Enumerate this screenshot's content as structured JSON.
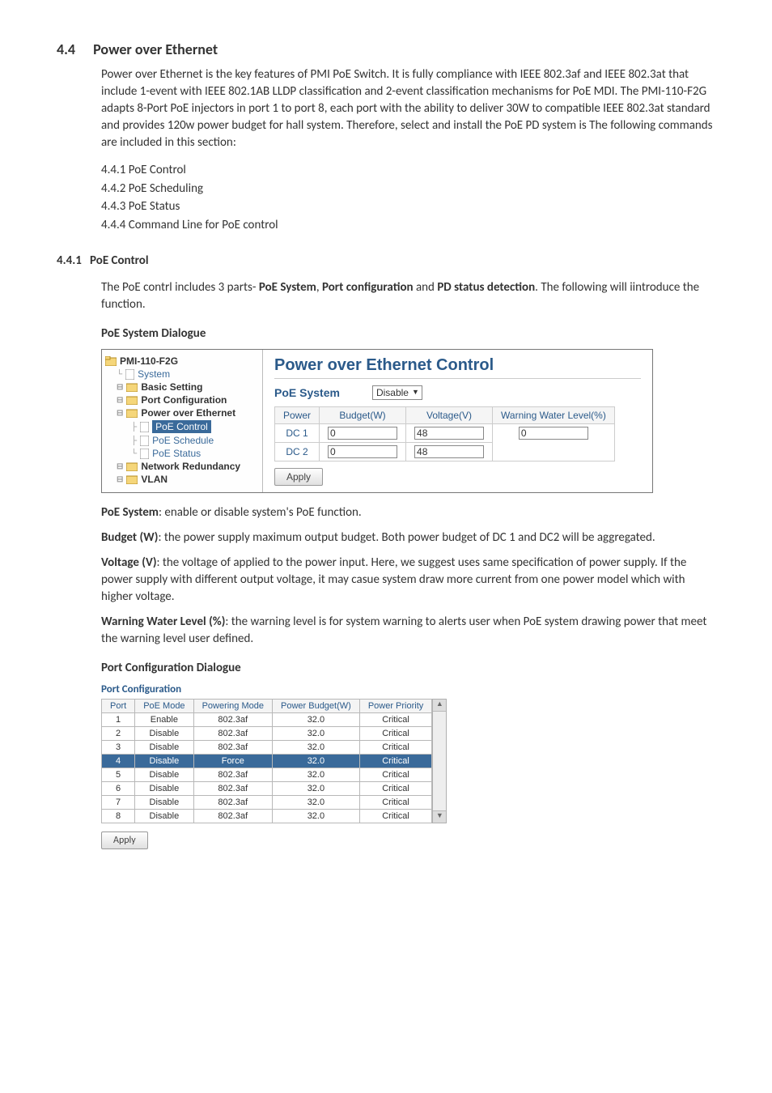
{
  "section": {
    "num": "4.4",
    "title": "Power over Ethernet"
  },
  "intro": "Power over Ethernet is the key features of PMI PoE Switch. It is fully compliance with IEEE 802.3af and IEEE 802.3at that include 1-event with IEEE 802.1AB LLDP classification and 2-event classification mechanisms for PoE MDI. The PMI-110-F2G adapts 8-Port PoE injectors in port 1 to port 8, each port with the ability to deliver 30W to compatible IEEE 802.3at standard and provides 120w power budget for hall system. Therefore, select and install the PoE PD system is The following commands are included in this section:",
  "sublist": [
    "4.4.1 PoE Control",
    "4.4.2 PoE Scheduling",
    "4.4.3 PoE Status",
    "4.4.4 Command Line for PoE control"
  ],
  "sub441": {
    "num": "4.4.1",
    "title": "PoE Control"
  },
  "sub441_text": "The PoE contrl includes 3 parts- PoE System, Port configuration and PD status detection. The following will iintroduce the function.",
  "poe_dialog_title": "PoE System Dialogue",
  "tree": {
    "root": "PMI-110-F2G",
    "items": [
      "System",
      "Basic Setting",
      "Port Configuration",
      "Power over Ethernet",
      "PoE Control",
      "PoE Schedule",
      "PoE Status",
      "Network Redundancy",
      "VLAN"
    ]
  },
  "poe_panel": {
    "title": "Power over Ethernet Control",
    "sys_label": "PoE System",
    "sys_value": "Disable",
    "headers": [
      "Power",
      "Budget(W)",
      "Voltage(V)",
      "Warning Water Level(%)"
    ],
    "rows": [
      {
        "power": "DC 1",
        "budget": "0",
        "voltage": "48",
        "wwl": "0"
      },
      {
        "power": "DC 2",
        "budget": "0",
        "voltage": "48",
        "wwl": ""
      }
    ],
    "apply": "Apply"
  },
  "desc": {
    "poe_system_lbl": "PoE System",
    "poe_system_txt": ": enable or disable system's PoE function.",
    "budget_lbl": "Budget (W)",
    "budget_txt": ": the power supply maximum output budget. Both power budget of DC 1 and DC2 will be aggregated.",
    "voltage_lbl": "Voltage (V)",
    "voltage_txt": ": the voltage of applied to the power input. Here, we suggest uses same specification of power supply. If the power supply with different output voltage, it may casue system draw more current from one power model which with higher voltage.",
    "wwl_lbl": "Warning Water Level (%)",
    "wwl_txt": ": the warning level is for system warning to alerts user when PoE system drawing power that meet the warning level user defined."
  },
  "port_conf_heading": "Port Configuration Dialogue",
  "port_conf_title": "Port Configuration",
  "port_headers": [
    "Port",
    "PoE Mode",
    "Powering Mode",
    "Power Budget(W)",
    "Power Priority"
  ],
  "port_rows": [
    {
      "port": "1",
      "mode": "Enable",
      "pm": "802.3af",
      "pb": "32.0",
      "pp": "Critical",
      "sel": false
    },
    {
      "port": "2",
      "mode": "Disable",
      "pm": "802.3af",
      "pb": "32.0",
      "pp": "Critical",
      "sel": false
    },
    {
      "port": "3",
      "mode": "Disable",
      "pm": "802.3af",
      "pb": "32.0",
      "pp": "Critical",
      "sel": false
    },
    {
      "port": "4",
      "mode": "Disable",
      "pm": "Force",
      "pb": "32.0",
      "pp": "Critical",
      "sel": true
    },
    {
      "port": "5",
      "mode": "Disable",
      "pm": "802.3af",
      "pb": "32.0",
      "pp": "Critical",
      "sel": false
    },
    {
      "port": "6",
      "mode": "Disable",
      "pm": "802.3af",
      "pb": "32.0",
      "pp": "Critical",
      "sel": false
    },
    {
      "port": "7",
      "mode": "Disable",
      "pm": "802.3af",
      "pb": "32.0",
      "pp": "Critical",
      "sel": false
    },
    {
      "port": "8",
      "mode": "Disable",
      "pm": "802.3af",
      "pb": "32.0",
      "pp": "Critical",
      "sel": false
    }
  ],
  "apply2": "Apply"
}
